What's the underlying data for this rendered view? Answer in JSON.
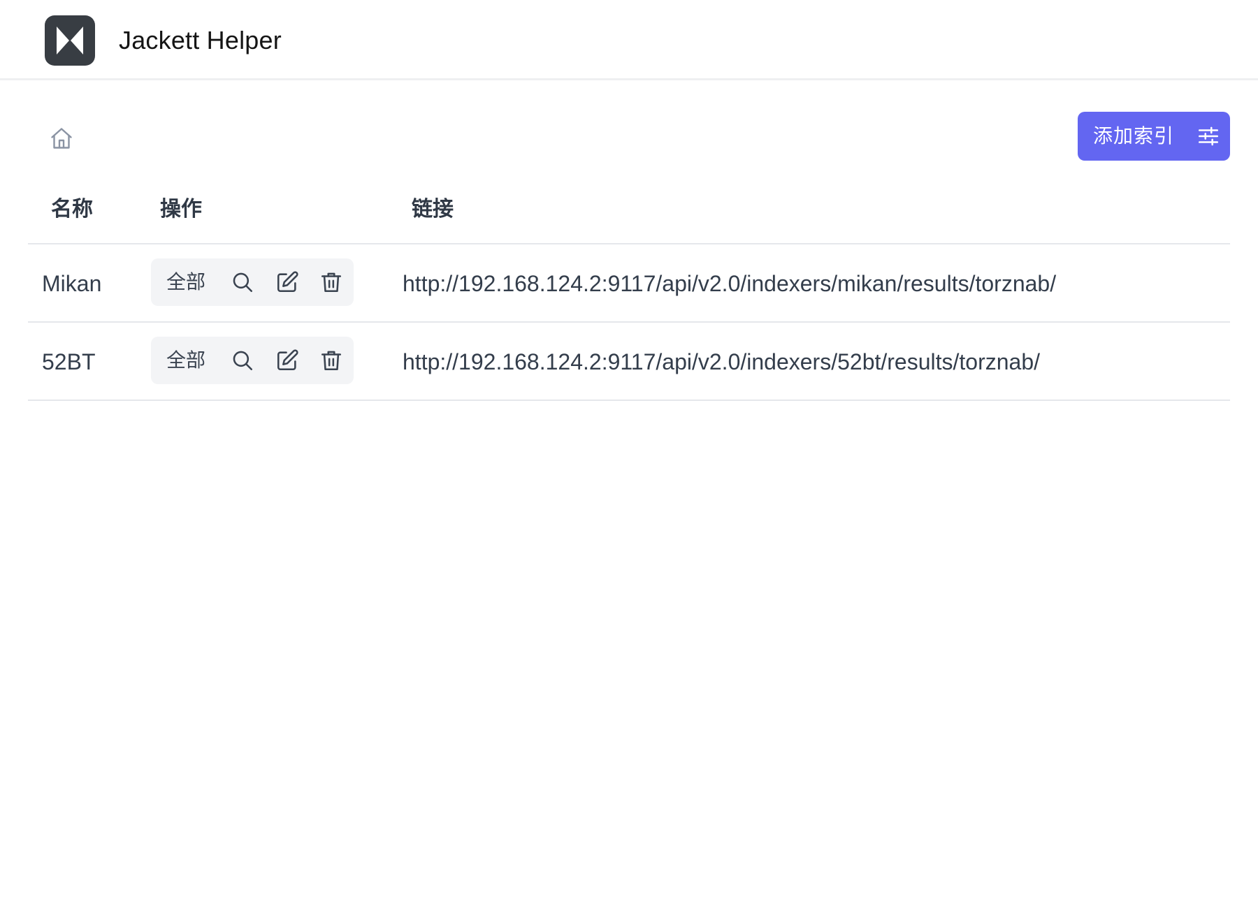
{
  "app": {
    "title": "Jackett Helper",
    "logo_icon": "jackett-logo-icon"
  },
  "toolbar": {
    "home_icon": "home-icon",
    "add_button_label": "添加索引",
    "add_button_icon": "sliders-icon",
    "accent_color": "#6366f1"
  },
  "table": {
    "headers": {
      "name": "名称",
      "actions": "操作",
      "link": "链接"
    },
    "rows": [
      {
        "name": "Mikan",
        "action_all_label": "全部",
        "link": "http://192.168.124.2:9117/api/v2.0/indexers/mikan/results/torznab/"
      },
      {
        "name": "52BT",
        "action_all_label": "全部",
        "link": "http://192.168.124.2:9117/api/v2.0/indexers/52bt/results/torznab/"
      }
    ],
    "row_action_icons": [
      "search-icon",
      "edit-icon",
      "trash-icon"
    ]
  }
}
